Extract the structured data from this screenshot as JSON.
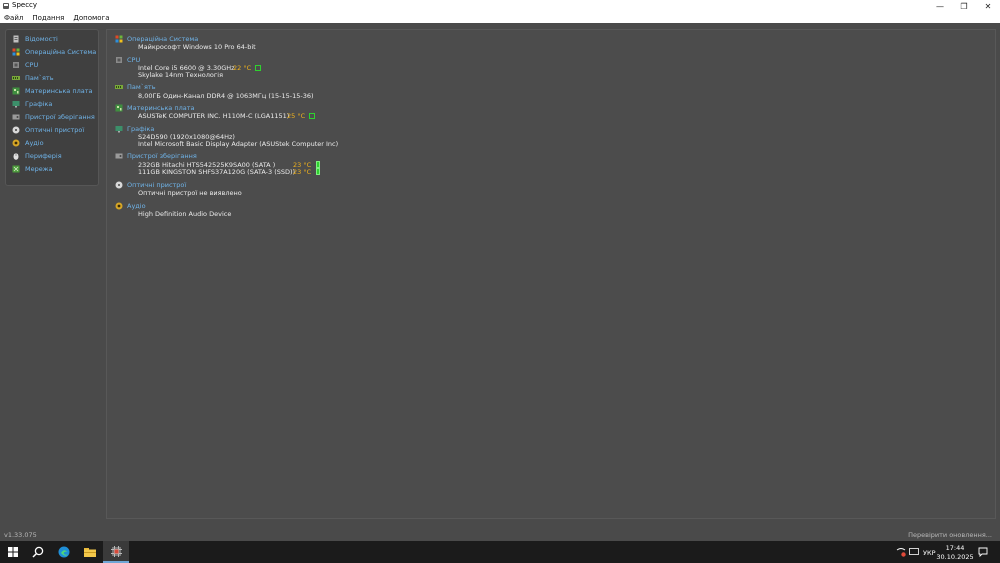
{
  "window": {
    "title": "Speccy",
    "minimize_glyph": "—",
    "restore_glyph": "❐",
    "close_glyph": "✕"
  },
  "menu": [
    "Файл",
    "Подання",
    "Допомога"
  ],
  "sidebar": {
    "items": [
      {
        "label": "Відомості",
        "icon": "summary-icon",
        "color": "#c0c0c0"
      },
      {
        "label": "Операційна Система",
        "icon": "windows-icon",
        "color": "#e07b26"
      },
      {
        "label": "CPU",
        "icon": "cpu-icon",
        "color": "#8a8a8a"
      },
      {
        "label": "Пам`ять",
        "icon": "ram-icon",
        "color": "#7aa83a"
      },
      {
        "label": "Материнська плата",
        "icon": "motherboard-icon",
        "color": "#3f8f3f"
      },
      {
        "label": "Графіка",
        "icon": "graphics-icon",
        "color": "#3c8f6a"
      },
      {
        "label": "Пристрої зберігання",
        "icon": "storage-icon",
        "color": "#9a9a9a"
      },
      {
        "label": "Оптичні пристрої",
        "icon": "optical-disc-icon",
        "color": "#d8d8d8"
      },
      {
        "label": "Аудіо",
        "icon": "audio-icon",
        "color": "#d6a626"
      },
      {
        "label": "Периферія",
        "icon": "peripheral-icon",
        "color": "#e0e0e0"
      },
      {
        "label": "Мережа",
        "icon": "network-icon",
        "color": "#4c9c3c"
      }
    ]
  },
  "main": {
    "os": {
      "title": "Операційна Система",
      "lines": [
        "Майкрософт Windows 10 Pro 64-bit"
      ]
    },
    "cpu": {
      "title": "CPU",
      "lines": [
        "Intel Core i5 6600 @ 3.30GHz",
        "Skylake 14nm Технологія"
      ],
      "temp": "22 °C"
    },
    "ram": {
      "title": "Пам`ять",
      "lines": [
        "8,00ГБ Один-Канал DDR4 @ 1063МГц (15-15-15-36)"
      ]
    },
    "motherboard": {
      "title": "Материнська плата",
      "lines": [
        "ASUSTeK COMPUTER INC. H110M-C (LGA1151)"
      ],
      "temp": "25 °C"
    },
    "graphics": {
      "title": "Графіка",
      "lines": [
        "S24D590 (1920x1080@64Hz)",
        "Intel Microsoft Basic Display Adapter (ASUStek Computer Inc)"
      ]
    },
    "storage": {
      "title": "Пристрої зберігання",
      "lines": [
        "232GB Hitachi HTS542525K9SA00 (SATA )",
        "111GB KINGSTON SHFS37A120G (SATA-3 (SSD))"
      ],
      "temps": [
        "23 °C",
        "23 °C"
      ]
    },
    "optical": {
      "title": "Оптичні пристрої",
      "lines": [
        "Оптичні пристрої не виявлено"
      ]
    },
    "audio": {
      "title": "Аудіо",
      "lines": [
        "High Definition Audio Device"
      ]
    }
  },
  "status": {
    "version": "v1.33.075",
    "update": "Перевірити оновлення..."
  },
  "taskbar": {
    "language": "УКР",
    "time": "17:44",
    "date": "30.10.2025"
  },
  "colors": {
    "accent_blue": "#6fb3e8",
    "temp_orange": "#f2b31c",
    "temp_green": "#2fd12f"
  }
}
